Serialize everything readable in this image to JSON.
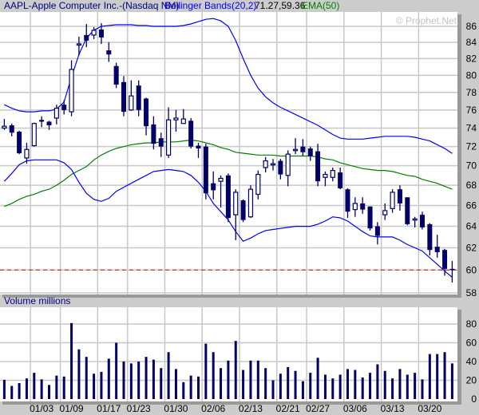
{
  "header": {
    "title": "AAPL-Apple Computer Inc.-(Nasdaq NM)",
    "indicator_label": "Bollinger Bands(20,2)",
    "indicator_values": "71.27,59.36",
    "ema_label": "EMA(50)"
  },
  "watermark": "© Prophet.Net",
  "volume_panel": {
    "title": "Volume  millions"
  },
  "colors": {
    "background": "#cccccc",
    "plot_background": "#ffffff",
    "grid": "#c8c8c8",
    "candle": "#000066",
    "bollinger": "#0000ff",
    "ema": "#008000",
    "last_price_line": "#cc0000",
    "title": "#000080"
  },
  "chart_data": [
    {
      "type": "candlestick",
      "symbol": "AAPL",
      "y_scale": "log",
      "ylim": [
        58,
        86
      ],
      "y_ticks": [
        "86",
        "84",
        "82",
        "80",
        "78",
        "76",
        "74",
        "72",
        "70",
        "68",
        "66",
        "64",
        "62",
        "60",
        "58"
      ],
      "grid": true,
      "last_price_line": 60.0,
      "x_ticks": [
        {
          "label": "01/03",
          "bar": 6
        },
        {
          "label": "01/09",
          "bar": 10
        },
        {
          "label": "01/17",
          "bar": 15
        },
        {
          "label": "01/23",
          "bar": 19
        },
        {
          "label": "01/30",
          "bar": 24
        },
        {
          "label": "02/06",
          "bar": 29
        },
        {
          "label": "02/13",
          "bar": 34
        },
        {
          "label": "02/21",
          "bar": 39
        },
        {
          "label": "02/27",
          "bar": 43
        },
        {
          "label": "03/06",
          "bar": 48
        },
        {
          "label": "03/13",
          "bar": 53
        },
        {
          "label": "03/20",
          "bar": 58
        }
      ],
      "ohlc": [
        [
          74.0,
          75.0,
          73.8,
          74.2
        ],
        [
          74.3,
          74.5,
          73.1,
          73.5
        ],
        [
          73.6,
          73.7,
          71.2,
          71.3
        ],
        [
          70.8,
          72.4,
          70.2,
          71.7
        ],
        [
          72.1,
          74.6,
          72.0,
          74.5
        ],
        [
          74.9,
          75.3,
          74.1,
          74.7
        ],
        [
          74.7,
          74.8,
          73.8,
          74.3
        ],
        [
          75.1,
          76.6,
          74.4,
          76.2
        ],
        [
          76.6,
          77.1,
          75.5,
          76.0
        ],
        [
          75.8,
          81.8,
          75.3,
          80.7
        ],
        [
          83.7,
          84.7,
          82.4,
          83.8
        ],
        [
          84.9,
          86.3,
          83.4,
          84.2
        ],
        [
          84.9,
          85.9,
          84.4,
          85.5
        ],
        [
          85.6,
          86.4,
          83.8,
          84.6
        ],
        [
          83.0,
          84.0,
          81.6,
          82.5
        ],
        [
          81.1,
          81.5,
          78.5,
          78.9
        ],
        [
          79.2,
          79.9,
          75.3,
          75.8
        ],
        [
          76.0,
          79.4,
          75.9,
          77.6
        ],
        [
          78.8,
          79.4,
          75.3,
          76.0
        ],
        [
          77.3,
          77.4,
          73.2,
          74.2
        ],
        [
          74.4,
          75.3,
          71.7,
          72.3
        ],
        [
          72.9,
          73.5,
          70.9,
          72.0
        ],
        [
          71.1,
          76.3,
          70.8,
          74.9
        ],
        [
          74.9,
          76.0,
          73.6,
          75.1
        ],
        [
          74.5,
          76.1,
          74.5,
          75.0
        ],
        [
          74.8,
          75.1,
          71.8,
          72.0
        ],
        [
          72.1,
          72.4,
          70.8,
          71.8
        ],
        [
          72.0,
          72.3,
          66.6,
          67.2
        ],
        [
          68.2,
          69.4,
          66.6,
          67.5
        ],
        [
          68.4,
          69.0,
          65.8,
          68.7
        ],
        [
          69.0,
          69.2,
          64.4,
          64.8
        ],
        [
          65.1,
          67.6,
          62.7,
          67.3
        ],
        [
          66.5,
          66.6,
          64.4,
          64.6
        ],
        [
          64.9,
          68.0,
          64.8,
          67.6
        ],
        [
          67.1,
          69.5,
          66.6,
          69.1
        ],
        [
          69.8,
          70.9,
          69.3,
          70.5
        ],
        [
          70.2,
          70.7,
          69.5,
          70.2
        ],
        [
          70.5,
          70.7,
          68.6,
          69.1
        ],
        [
          69.0,
          71.6,
          67.9,
          71.2
        ],
        [
          71.7,
          72.9,
          71.2,
          71.7
        ],
        [
          72.0,
          72.8,
          71.0,
          71.4
        ],
        [
          71.8,
          72.0,
          70.5,
          71.0
        ],
        [
          71.5,
          72.3,
          67.9,
          68.4
        ],
        [
          68.8,
          69.4,
          67.9,
          69.1
        ],
        [
          68.8,
          69.8,
          68.4,
          69.5
        ],
        [
          69.3,
          69.8,
          67.6,
          67.7
        ],
        [
          67.6,
          67.7,
          64.8,
          65.4
        ],
        [
          65.6,
          66.8,
          64.9,
          66.2
        ],
        [
          66.2,
          66.8,
          65.2,
          65.6
        ],
        [
          65.9,
          65.9,
          63.6,
          63.8
        ],
        [
          64.0,
          64.4,
          62.3,
          63.1
        ],
        [
          65.1,
          66.2,
          64.6,
          65.5
        ],
        [
          65.7,
          67.6,
          65.3,
          67.3
        ],
        [
          67.6,
          68.0,
          65.5,
          66.2
        ],
        [
          66.8,
          66.8,
          64.1,
          64.2
        ],
        [
          64.7,
          64.9,
          63.9,
          64.7
        ],
        [
          65.1,
          65.4,
          63.7,
          63.9
        ],
        [
          64.2,
          64.3,
          61.3,
          61.8
        ],
        [
          62.1,
          63.2,
          61.1,
          61.6
        ],
        [
          61.8,
          61.9,
          59.5,
          60.1
        ],
        [
          60.1,
          60.8,
          58.9,
          60.0
        ]
      ],
      "bollinger_upper": [
        76.6,
        76.2,
        75.9,
        75.8,
        75.8,
        75.9,
        75.9,
        76.1,
        76.9,
        79.8,
        82.5,
        84.5,
        85.5,
        86.0,
        86.1,
        86.2,
        86.2,
        86.2,
        86.1,
        86.1,
        86.0,
        86.0,
        86.0,
        86.0,
        86.1,
        86.3,
        86.6,
        86.9,
        87.0,
        86.7,
        86.0,
        84.2,
        82.0,
        80.0,
        78.5,
        77.5,
        76.8,
        76.3,
        75.9,
        75.5,
        75.1,
        74.7,
        74.3,
        73.8,
        73.3,
        72.9,
        72.8,
        72.8,
        72.8,
        72.9,
        73.0,
        73.1,
        73.1,
        73.1,
        73.1,
        73.0,
        72.8,
        72.6,
        72.2,
        71.8,
        71.27
      ],
      "bollinger_lower": [
        68.4,
        69.2,
        70.1,
        70.5,
        70.6,
        70.6,
        70.6,
        70.6,
        70.3,
        69.6,
        68.3,
        67.2,
        66.6,
        66.4,
        66.7,
        67.4,
        67.8,
        68.2,
        68.6,
        69.0,
        69.4,
        69.5,
        69.6,
        69.5,
        69.4,
        69.0,
        68.3,
        67.4,
        66.2,
        65.4,
        64.6,
        63.5,
        62.6,
        62.9,
        63.3,
        63.6,
        63.7,
        63.8,
        63.9,
        64.0,
        64.0,
        64.0,
        64.2,
        64.5,
        64.9,
        64.8,
        64.5,
        64.0,
        63.5,
        63.1,
        63.0,
        63.0,
        63.0,
        62.7,
        62.3,
        62.0,
        61.7,
        61.1,
        60.5,
        59.9,
        59.36
      ],
      "ema50": [
        65.9,
        66.2,
        66.6,
        66.9,
        67.1,
        67.4,
        67.6,
        68.0,
        68.5,
        69.1,
        69.5,
        69.9,
        70.6,
        71.1,
        71.5,
        71.8,
        72.0,
        72.2,
        72.3,
        72.4,
        72.4,
        72.5,
        72.5,
        72.5,
        72.6,
        72.7,
        72.6,
        72.4,
        72.2,
        71.9,
        71.7,
        71.4,
        71.3,
        71.2,
        71.1,
        71.1,
        71.1,
        71.0,
        71.0,
        71.0,
        71.0,
        71.0,
        70.9,
        70.7,
        70.6,
        70.3,
        70.1,
        69.9,
        69.7,
        69.6,
        69.5,
        69.5,
        69.4,
        69.2,
        69.0,
        68.9,
        68.6,
        68.4,
        68.2,
        67.9,
        67.6
      ]
    },
    {
      "type": "bar",
      "ylabel": "Volume  millions",
      "ylim": [
        0,
        90
      ],
      "y_ticks": [
        "80",
        "60",
        "40",
        "20",
        "0"
      ],
      "grid": true,
      "values": [
        20.5,
        14,
        17,
        22,
        28,
        21,
        15,
        25,
        24,
        81,
        53,
        45,
        27,
        29,
        43,
        60,
        40,
        38,
        40,
        45,
        42,
        33,
        50,
        32,
        18,
        25,
        24,
        59,
        50,
        33,
        41,
        62,
        31,
        41,
        41,
        33,
        20,
        27,
        34,
        30,
        19,
        28,
        44,
        26,
        22,
        26,
        32,
        31,
        23,
        28,
        37,
        30,
        22,
        32,
        26,
        28,
        21,
        48,
        48,
        50,
        38
      ]
    }
  ]
}
